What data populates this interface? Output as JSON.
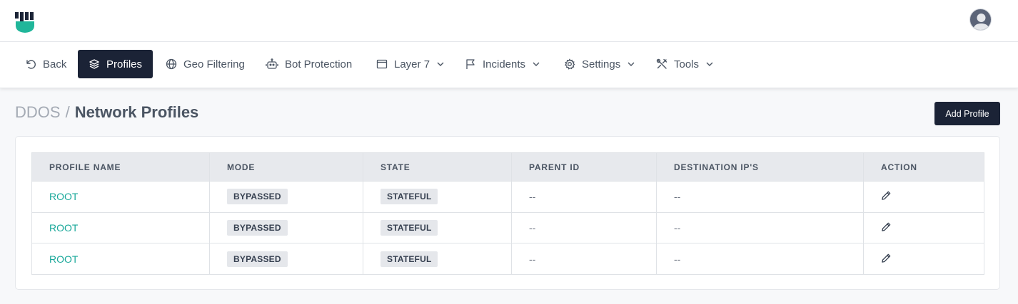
{
  "header": {
    "logo_icon": "shield-logo-icon",
    "avatar_icon": "user-avatar-icon",
    "accent": "#20b69a"
  },
  "nav": {
    "back": "Back",
    "profiles": "Profiles",
    "geo_filtering": "Geo Filtering",
    "bot_protection": "Bot Protection",
    "layer7": "Layer 7",
    "incidents": "Incidents",
    "settings": "Settings",
    "tools": "Tools",
    "active_color": "#1b2336"
  },
  "page": {
    "breadcrumb_root": "DDOS",
    "breadcrumb_sep": "/",
    "title": "Network Profiles",
    "add_button": "Add Profile"
  },
  "table": {
    "columns": [
      "PROFILE NAME",
      "MODE",
      "STATE",
      "PARENT ID",
      "DESTINATION IP'S",
      "ACTION"
    ],
    "rows": [
      {
        "name": "ROOT",
        "mode": "BYPASSED",
        "state": "STATEFUL",
        "parent_id": "--",
        "destination_ips": "--",
        "action_icon": "pencil-icon"
      },
      {
        "name": "ROOT",
        "mode": "BYPASSED",
        "state": "STATEFUL",
        "parent_id": "--",
        "destination_ips": "--",
        "action_icon": "pencil-icon"
      },
      {
        "name": "ROOT",
        "mode": "BYPASSED",
        "state": "STATEFUL",
        "parent_id": "--",
        "destination_ips": "--",
        "action_icon": "pencil-icon"
      }
    ]
  }
}
